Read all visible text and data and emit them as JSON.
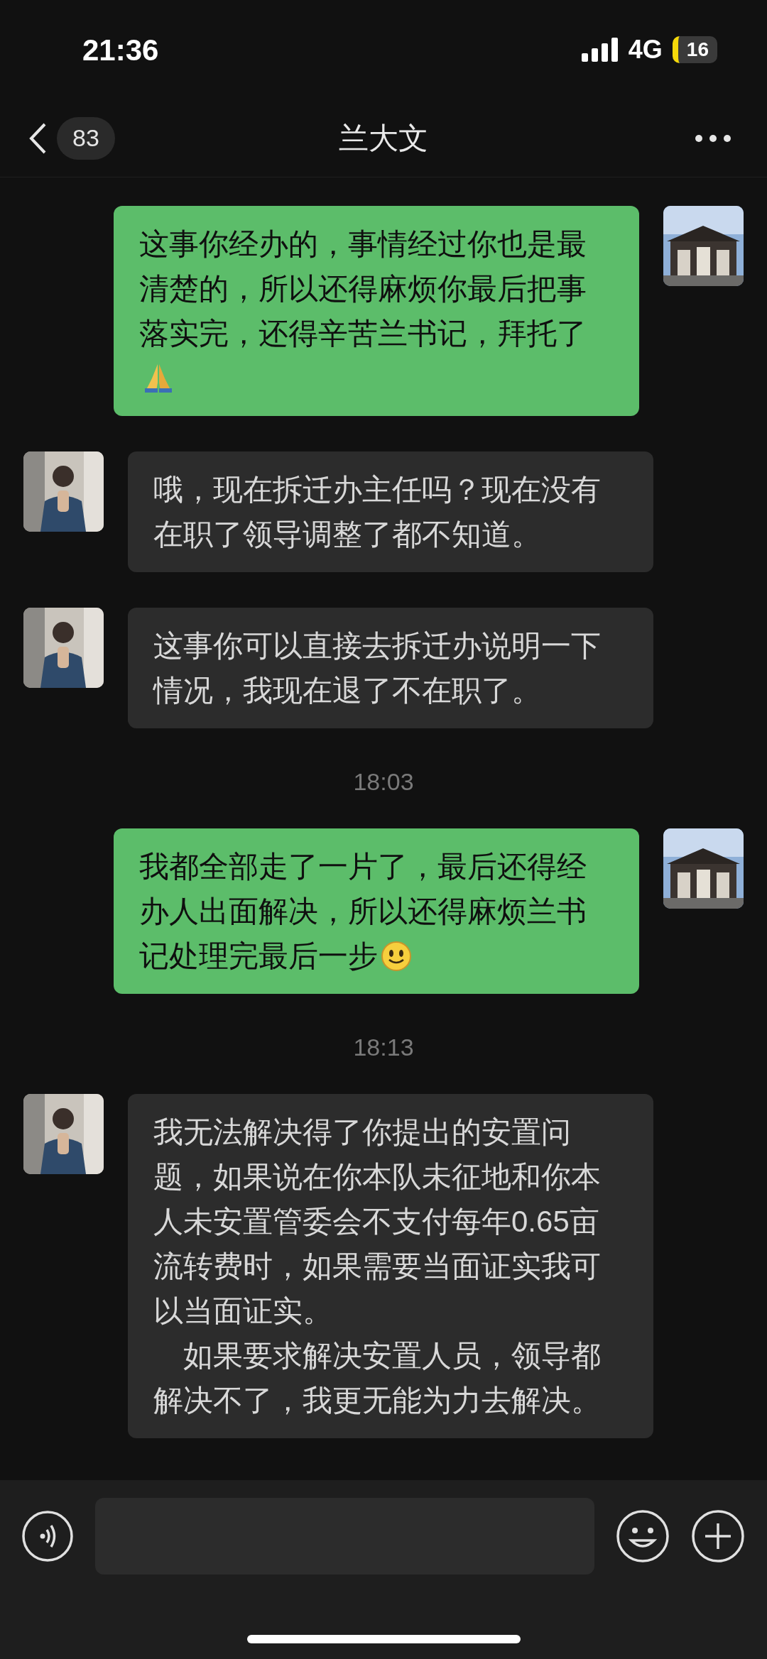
{
  "status_bar": {
    "time": "21:36",
    "network": "4G",
    "battery": "16"
  },
  "header": {
    "unread_count": "83",
    "title": "兰大文"
  },
  "messages": [
    {
      "kind": "message",
      "outgoing": true,
      "paragraphs": [
        "这事你经办的，事情经过你也是最清楚的，所以还得麻烦你最后把事落实完，还得辛苦兰书记，拜托了"
      ],
      "emoji": {
        "kind": "pray"
      }
    },
    {
      "kind": "message",
      "outgoing": false,
      "paragraphs": [
        "哦，现在拆迁办主任吗？现在没有在职了领导调整了都不知道。"
      ]
    },
    {
      "kind": "message",
      "outgoing": false,
      "paragraphs": [
        "这事你可以直接去拆迁办说明一下情况，我现在退了不在职了。"
      ]
    },
    {
      "kind": "time",
      "text": "18:03"
    },
    {
      "kind": "message",
      "outgoing": true,
      "paragraphs": [
        "我都全部走了一片了，最后还得经办人出面解决，所以还得麻烦兰书记处理完最后一步"
      ],
      "emoji": {
        "kind": "smile"
      }
    },
    {
      "kind": "time",
      "text": "18:13"
    },
    {
      "kind": "message",
      "outgoing": false,
      "paragraphs": [
        "我无法解决得了你提出的安置问题，如果说在你本队未征地和你本人未安置管委会不支付每年0.65亩流转费时，如果需要当面证实我可以当面证实。",
        "　如果要求解决安置人员，领导都解决不了，我更无能为力去解决。"
      ]
    }
  ]
}
